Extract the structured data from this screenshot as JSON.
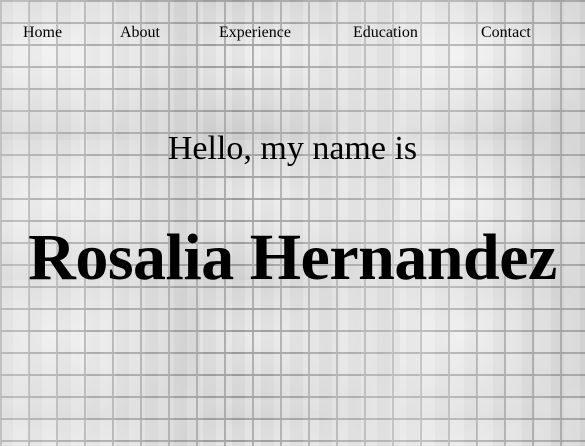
{
  "nav": {
    "items": [
      {
        "label": "Home"
      },
      {
        "label": "About"
      },
      {
        "label": "Experience"
      },
      {
        "label": "Education"
      },
      {
        "label": "Contact"
      }
    ]
  },
  "hero": {
    "greeting": "Hello, my name is",
    "name": "Rosalia Hernandez"
  },
  "colors": {
    "text": "#000000",
    "background": "#d9d9d9"
  }
}
